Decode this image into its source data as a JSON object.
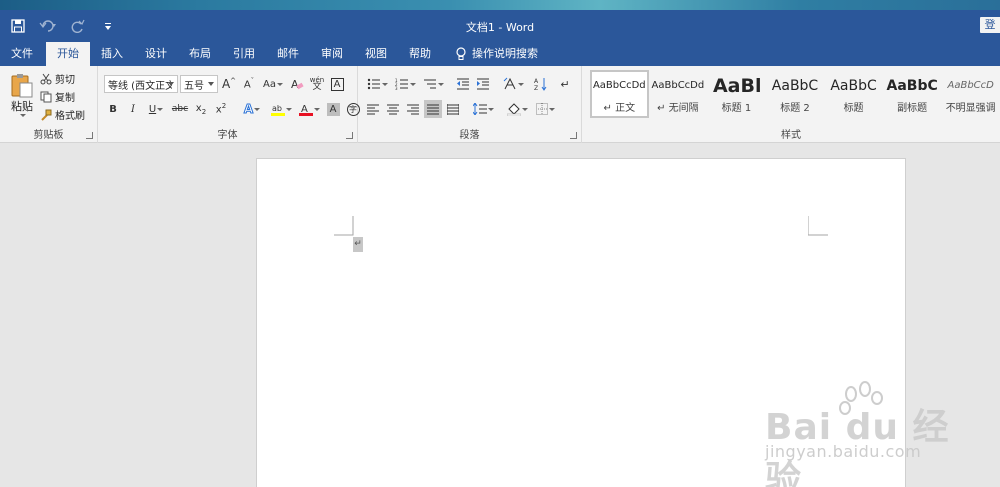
{
  "window": {
    "title": "文档1 - Word",
    "signin": "登"
  },
  "tabs": [
    "文件",
    "开始",
    "插入",
    "设计",
    "布局",
    "引用",
    "邮件",
    "审阅",
    "视图",
    "帮助"
  ],
  "active_tab": "开始",
  "tell_me": "操作说明搜索",
  "clipboard": {
    "paste": "粘贴",
    "cut": "剪切",
    "copy": "复制",
    "format_painter": "格式刷",
    "label": "剪贴板"
  },
  "font": {
    "name": "等线 (西文正文)",
    "size": "五号",
    "change_case": "Aa",
    "label": "字体",
    "phonetic_top": "wén"
  },
  "paragraph": {
    "label": "段落"
  },
  "styles": {
    "label": "样式",
    "items": [
      {
        "sample": "AaBbCcDd",
        "name": "↵ 正文"
      },
      {
        "sample": "AaBbCcDd",
        "name": "↵ 无间隔"
      },
      {
        "sample": "AaBl",
        "name": "标题 1"
      },
      {
        "sample": "AaBbC",
        "name": "标题 2"
      },
      {
        "sample": "AaBbC",
        "name": "标题"
      },
      {
        "sample": "AaBbC",
        "name": "副标题"
      },
      {
        "sample": "AaBbCcD",
        "name": "不明显强调"
      }
    ]
  },
  "document": {
    "paragraph_mark": "↵"
  },
  "watermark": {
    "brand": "Bai du 经验",
    "url": "jingyan.baidu.com"
  },
  "colors": {
    "title_bar": "#2b579a",
    "ribbon": "#f3f3f3",
    "highlight": "#ffff00",
    "font_color": "#e81123"
  }
}
